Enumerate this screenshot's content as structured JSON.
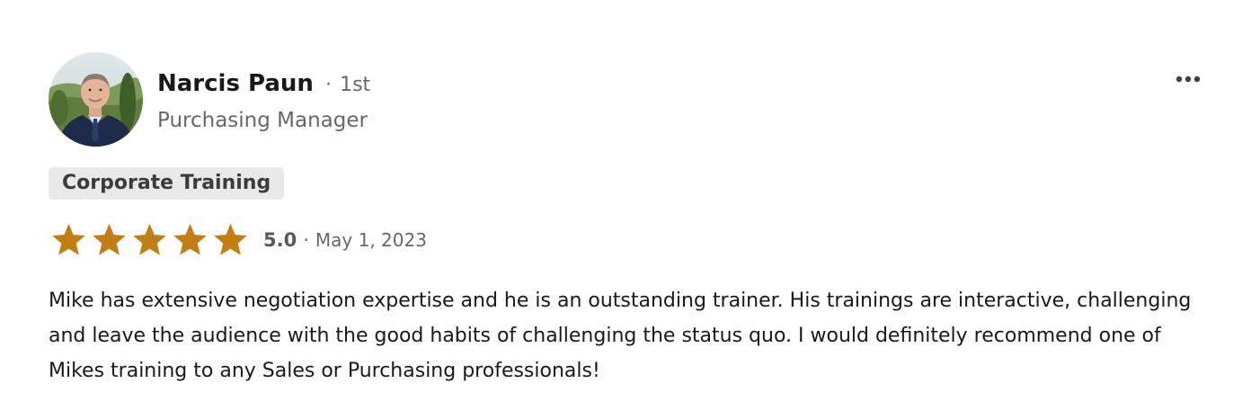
{
  "reviewer": {
    "name": "Narcis Paun",
    "degree_separator": "·",
    "degree": "1st",
    "headline": "Purchasing Manager",
    "avatar_icon": "profile-photo"
  },
  "menu": {
    "icon": "more-horizontal-icon"
  },
  "service": {
    "label": "Corporate Training"
  },
  "rating": {
    "stars": 5,
    "max_stars": 5,
    "value": "5.0",
    "separator": "·",
    "date": "May 1, 2023",
    "star_color": "#c37d16"
  },
  "review": {
    "text": "Mike has extensive negotiation expertise and he is an outstanding trainer. His trainings are interactive, challenging and leave the audience with the good habits of challenging the status quo. I would definitely recommend one of Mikes training to any Sales or Purchasing professionals!"
  }
}
